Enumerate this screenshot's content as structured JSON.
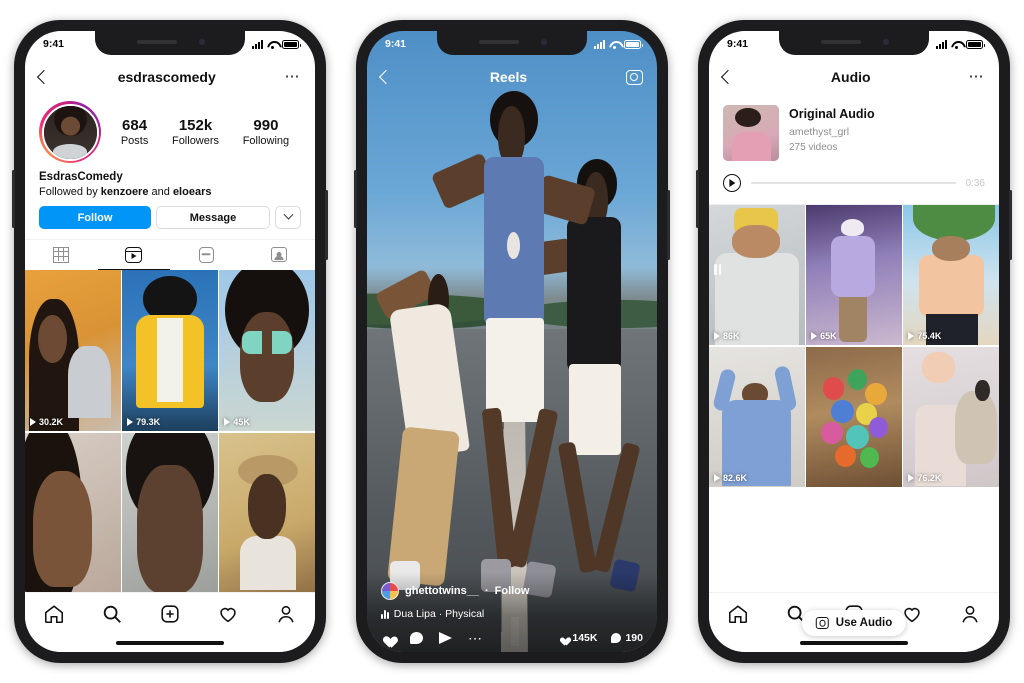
{
  "status_bar": {
    "time": "9:41",
    "signal_icon": "cellular-bars-icon",
    "wifi_icon": "wifi-icon",
    "battery_icon": "battery-icon"
  },
  "phone1": {
    "nav": {
      "back_icon": "chevron-left-icon",
      "title": "esdrascomedy",
      "more_icon": "ellipsis-icon"
    },
    "profile": {
      "avatar_name": "avatar",
      "stats": [
        {
          "num": "684",
          "label": "Posts"
        },
        {
          "num": "152k",
          "label": "Followers"
        },
        {
          "num": "990",
          "label": "Following"
        }
      ],
      "display_name": "EsdrasComedy",
      "followed_by_prefix": "Followed by ",
      "followed_by_user1": "kenzoere",
      "followed_by_join": " and ",
      "followed_by_user2": "eloears",
      "follow_button": "Follow",
      "message_button": "Message",
      "caret_icon": "chevron-down-icon"
    },
    "tabs": [
      {
        "name": "grid-tab",
        "icon": "grid-icon",
        "active": false
      },
      {
        "name": "reels-tab",
        "icon": "reels-icon",
        "active": true
      },
      {
        "name": "igtv-tab",
        "icon": "igtv-icon",
        "active": false
      },
      {
        "name": "tagged-tab",
        "icon": "tagged-icon",
        "active": false
      }
    ],
    "grid": [
      {
        "views": "30.2K"
      },
      {
        "views": "79.3K"
      },
      {
        "views": "45K"
      },
      {
        "views": ""
      },
      {
        "views": ""
      },
      {
        "views": ""
      }
    ]
  },
  "phone2": {
    "nav": {
      "back_icon": "chevron-left-icon",
      "title": "Reels",
      "camera_icon": "camera-icon"
    },
    "overlay": {
      "username": "ghettotwins__",
      "separator": " · ",
      "follow_label": "Follow",
      "audio_icon": "music-note-icon",
      "audio_text": "Dua Lipa · Physical",
      "like_icon": "heart-icon",
      "comment_icon": "comment-icon",
      "share_icon": "paper-plane-icon",
      "more_icon": "ellipsis-icon",
      "like_count": "145K",
      "comment_count": "190"
    }
  },
  "phone3": {
    "nav": {
      "back_icon": "chevron-left-icon",
      "title": "Audio",
      "more_icon": "ellipsis-icon"
    },
    "audio": {
      "thumb_name": "audio-cover-thumbnail",
      "title": "Original Audio",
      "author": "amethyst_grl",
      "video_count": "275 videos",
      "play_icon": "play-circle-icon",
      "duration": "0:36"
    },
    "use_audio": {
      "icon": "camera-icon",
      "label": "Use Audio"
    },
    "grid": [
      {
        "views": "86K"
      },
      {
        "views": "65K"
      },
      {
        "views": "75.4K"
      },
      {
        "views": "82.6K"
      },
      {
        "views": ""
      },
      {
        "views": "76.2K"
      }
    ]
  },
  "bottom_nav": [
    {
      "name": "home-tab",
      "icon": "home-icon"
    },
    {
      "name": "search-tab",
      "icon": "search-icon"
    },
    {
      "name": "create-tab",
      "icon": "plus-square-icon"
    },
    {
      "name": "activity-tab",
      "icon": "heart-icon"
    },
    {
      "name": "profile-tab",
      "icon": "person-icon"
    }
  ],
  "colors": {
    "accent": "#0095F6",
    "text": "#111111",
    "muted": "#8E8E8E",
    "border": "#DBDBDB"
  }
}
